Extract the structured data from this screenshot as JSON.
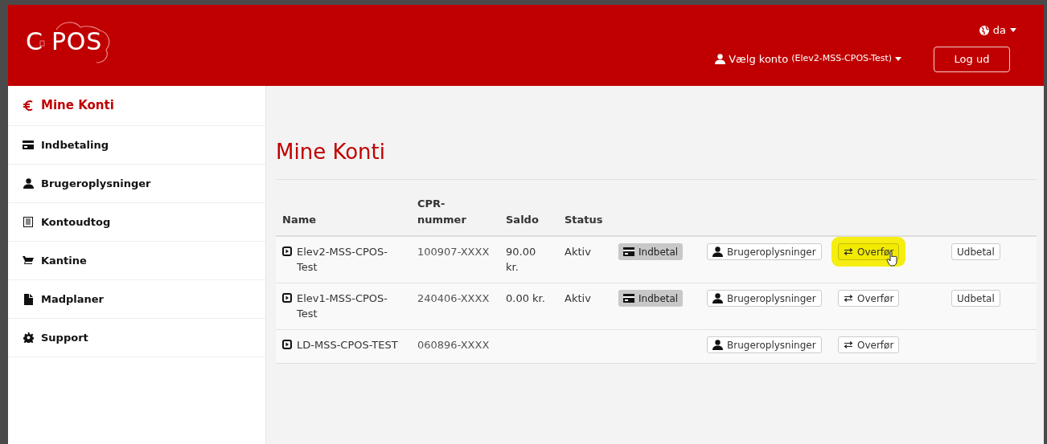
{
  "header": {
    "logo": "C POS",
    "language": "da",
    "account_label": "Vælg konto",
    "account_name": "(Elev2-MSS-CPOS-Test)",
    "logout": "Log ud"
  },
  "sidebar": {
    "items": [
      {
        "label": "Mine Konti",
        "kind": "euro",
        "selected": true
      },
      {
        "label": "Indbetaling",
        "kind": "card",
        "selected": false
      },
      {
        "label": "Brugeroplysninger",
        "kind": "user",
        "selected": false
      },
      {
        "label": "Kontoudtog",
        "kind": "list",
        "selected": false
      },
      {
        "label": "Kantine",
        "kind": "cart",
        "selected": false
      },
      {
        "label": "Madplaner",
        "kind": "file",
        "selected": false
      },
      {
        "label": "Support",
        "kind": "gear",
        "selected": false
      }
    ]
  },
  "page_title": "Mine Konti",
  "table": {
    "columns": [
      "Name",
      "CPR-nummer",
      "Saldo",
      "Status"
    ],
    "rows": [
      {
        "name": "Elev2-MSS-CPOS-Test",
        "cpr": "100907-XXXX",
        "saldo": "90.00 kr.",
        "status": "Aktiv",
        "actions": [
          {
            "kind": "deposit",
            "label": "Indbetal",
            "highlighted": false
          },
          {
            "kind": "user",
            "label": "Brugeroplysninger",
            "highlighted": false
          },
          {
            "kind": "transfer",
            "label": "Overfør",
            "highlighted": true
          },
          {
            "kind": "payout",
            "label": "Udbetal",
            "highlighted": false
          }
        ]
      },
      {
        "name": "Elev1-MSS-CPOS-Test",
        "cpr": "240406-XXXX",
        "saldo": "0.00 kr.",
        "status": "Aktiv",
        "actions": [
          {
            "kind": "deposit",
            "label": "Indbetal",
            "highlighted": false
          },
          {
            "kind": "user",
            "label": "Brugeroplysninger",
            "highlighted": false
          },
          {
            "kind": "transfer",
            "label": "Overfør",
            "highlighted": false
          },
          {
            "kind": "payout",
            "label": "Udbetal",
            "highlighted": false
          }
        ]
      },
      {
        "name": "LD-MSS-CPOS-TEST",
        "cpr": "060896-XXXX",
        "actions": [
          {
            "kind": "user",
            "label": "Brugeroplysninger",
            "highlighted": false
          },
          {
            "kind": "transfer",
            "label": "Overfør",
            "highlighted": false
          }
        ]
      }
    ]
  }
}
